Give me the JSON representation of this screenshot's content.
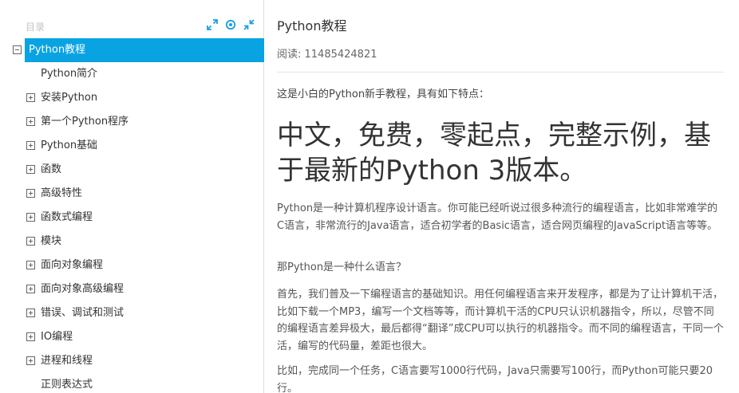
{
  "sidebar": {
    "title": "目录",
    "tools": [
      {
        "name": "expand-icon"
      },
      {
        "name": "locate-icon"
      },
      {
        "name": "collapse-icon"
      }
    ],
    "root": {
      "label": "Python教程",
      "expanded": true,
      "active": true
    },
    "items": [
      {
        "label": "Python简介",
        "has_children": false
      },
      {
        "label": "安装Python",
        "has_children": true
      },
      {
        "label": "第一个Python程序",
        "has_children": true
      },
      {
        "label": "Python基础",
        "has_children": true
      },
      {
        "label": "函数",
        "has_children": true
      },
      {
        "label": "高级特性",
        "has_children": true
      },
      {
        "label": "函数式编程",
        "has_children": true
      },
      {
        "label": "模块",
        "has_children": true
      },
      {
        "label": "面向对象编程",
        "has_children": true
      },
      {
        "label": "面向对象高级编程",
        "has_children": true
      },
      {
        "label": "错误、调试和测试",
        "has_children": true
      },
      {
        "label": "IO编程",
        "has_children": true
      },
      {
        "label": "进程和线程",
        "has_children": true
      },
      {
        "label": "正则表达式",
        "has_children": false
      }
    ]
  },
  "article": {
    "title": "Python教程",
    "reads_label": "阅读: 11485424821",
    "intro": "这是小白的Python新手教程，具有如下特点：",
    "headline": "中文，免费，零起点，完整示例，基于最新的Python 3版本。",
    "paragraphs": [
      "Python是一种计算机程序设计语言。你可能已经听说过很多种流行的编程语言，比如非常难学的C语言，非常流行的Java语言，适合初学者的Basic语言，适合网页编程的JavaScript语言等等。",
      "那Python是一种什么语言？",
      "首先，我们普及一下编程语言的基础知识。用任何编程语言来开发程序，都是为了让计算机干活，比如下载一个MP3，编写一个文档等等，而计算机干活的CPU只认识机器指令，所以，尽管不同的编程语言差异极大，最后都得“翻译”成CPU可以执行的机器指令。而不同的编程语言，干同一个活，编写的代码量，差距也很大。",
      "比如，完成同一个任务，C语言要写1000行代码，Java只需要写100行，而Python可能只要20行。"
    ]
  },
  "colors": {
    "accent": "#09a3e2",
    "text": "#333333",
    "muted": "#c3c3c3"
  }
}
